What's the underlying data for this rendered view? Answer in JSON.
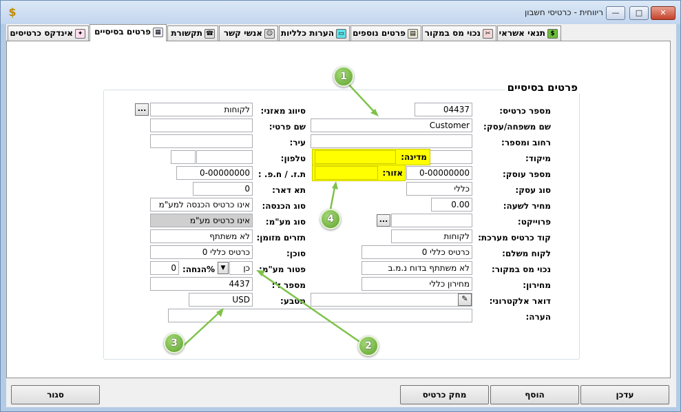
{
  "window": {
    "title": "ריווחית - כרטיסי חשבון",
    "app_icon": "$",
    "minimize": "—",
    "maximize": "□",
    "close": "✕"
  },
  "tabs": [
    {
      "label": "תנאי אשראי",
      "icon": "money-bag-icon"
    },
    {
      "label": "נכוי מס במקור",
      "icon": "tax-stamp-icon"
    },
    {
      "label": "פרטים נוספים",
      "icon": "book-icon"
    },
    {
      "label": "הערות כלליות",
      "icon": "notes-icon"
    },
    {
      "label": "אנשי קשר",
      "icon": "contacts-icon"
    },
    {
      "label": "תקשורת",
      "icon": "telephone-icon"
    },
    {
      "label": "פרטים בסיסיים",
      "icon": "form-icon"
    },
    {
      "label": "אינדקס כרטיסים",
      "icon": "index-cards-icon"
    }
  ],
  "group_title": "פרטים בסיסיים",
  "right_labels": {
    "card_number": "מספר כרטיס:",
    "family_name": "שם משפחה/עסק:",
    "street": "רחוב ומספר:",
    "zip": "מיקוד:",
    "business_number": "מספר עוסק:",
    "business_type": "סוג עסק:",
    "hourly_price": "מחיר לשעה:",
    "project": "פרוייקט:",
    "system_card_code": "קוד כרטיס מערכת:",
    "paying_customer": "לקוח משלם:",
    "withholding_tax": "נכוי מס במקור:",
    "price_list": "מחירון:",
    "email": "דואר אלקטרוני:",
    "note": "הערה:"
  },
  "right_values": {
    "card_number": "04437",
    "family_name": "Customer",
    "street": "",
    "zip": "",
    "business_number": "0-00000000",
    "business_type": "כללי",
    "hourly_price": "0.00",
    "project": "",
    "system_card_code": "לקוחות",
    "paying_customer": "כרטיס כללי 0",
    "withholding_tax": "לא משתתף בדוח נ.מ.ב",
    "price_list": "מחירון כללי",
    "email": "",
    "note": ""
  },
  "yellow_labels": {
    "country": "מדינה:",
    "region": "אזור:"
  },
  "left_labels": {
    "balance_sort": "סיווג מאזני:",
    "first_name": "שם פרטי:",
    "city": "עיר:",
    "phone": "טלפון:",
    "id_number": "ת.ז. / ח.פ. :",
    "po_box": "תא דאר:",
    "income_type": "סוג הכנסה:",
    "vat_type": "סוג מע\"מ:",
    "cash_flow": "תזרים מזומן:",
    "agent": "סוכן:",
    "vat_exempt": "פטור מע\"מ:",
    "discount": "%הנחה:",
    "sub_number": "מספר ז':",
    "currency": "מטבע:"
  },
  "left_values": {
    "balance_sort": "לקוחות",
    "first_name": "",
    "city": "",
    "phone_main": "",
    "phone_prefix": "",
    "id_number": "0-00000000",
    "po_box": "0",
    "income_type": "אינו כרטיס הכנסה למע\"מ",
    "vat_type": "אינו כרטיס מע\"מ",
    "cash_flow": "לא משתתף",
    "agent": "כרטיס כללי 0",
    "vat_exempt": "כן",
    "discount": "0",
    "sub_number": "4437",
    "currency": "USD"
  },
  "buttons": {
    "ellipsis": "...",
    "dropdown": "▼",
    "email_edit": "✎",
    "update": "עדכן",
    "add": "הוסף",
    "delete_card": "מחק כרטיס",
    "close": "סגור"
  },
  "callouts": [
    "1",
    "2",
    "3",
    "4"
  ],
  "colors": {
    "highlight": "#ffff00",
    "callout": "#6fb23a"
  }
}
